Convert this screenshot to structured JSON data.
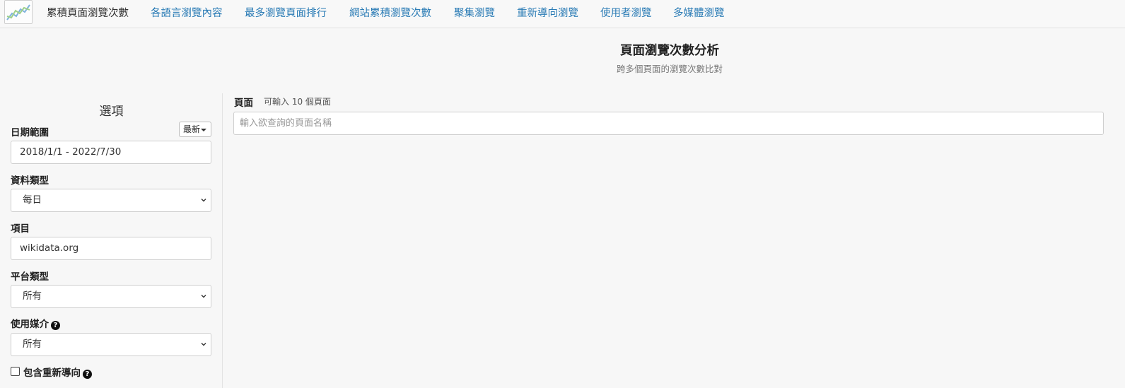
{
  "nav": {
    "items": [
      {
        "label": "累積頁面瀏覽次數",
        "active": true
      },
      {
        "label": "各語言瀏覽內容",
        "active": false
      },
      {
        "label": "最多瀏覽頁面排行",
        "active": false
      },
      {
        "label": "網站累積瀏覽次數",
        "active": false
      },
      {
        "label": "聚集瀏覽",
        "active": false
      },
      {
        "label": "重新導向瀏覽",
        "active": false
      },
      {
        "label": "使用者瀏覽",
        "active": false
      },
      {
        "label": "多媒體瀏覽",
        "active": false
      }
    ]
  },
  "header": {
    "title": "頁面瀏覽次數分析",
    "subtitle": "跨多個頁面的瀏覽次數比對"
  },
  "options": {
    "title": "選項",
    "date_range": {
      "label": "日期範圍",
      "value": "2018/1/1 - 2022/7/30",
      "latest_button": "最新"
    },
    "data_type": {
      "label": "資料類型",
      "value": "每日"
    },
    "project": {
      "label": "項目",
      "value": "wikidata.org"
    },
    "platform": {
      "label": "平台類型",
      "value": "所有"
    },
    "agent": {
      "label": "使用媒介",
      "value": "所有"
    },
    "include_redirects": {
      "label": "包含重新導向",
      "checked": false
    }
  },
  "pages": {
    "label": "頁面",
    "hint": "可輸入 10 個頁面",
    "placeholder": "輸入欲查詢的頁面名稱"
  },
  "colors": {
    "link": "#2a7bb5",
    "background": "#f7f7f7"
  }
}
